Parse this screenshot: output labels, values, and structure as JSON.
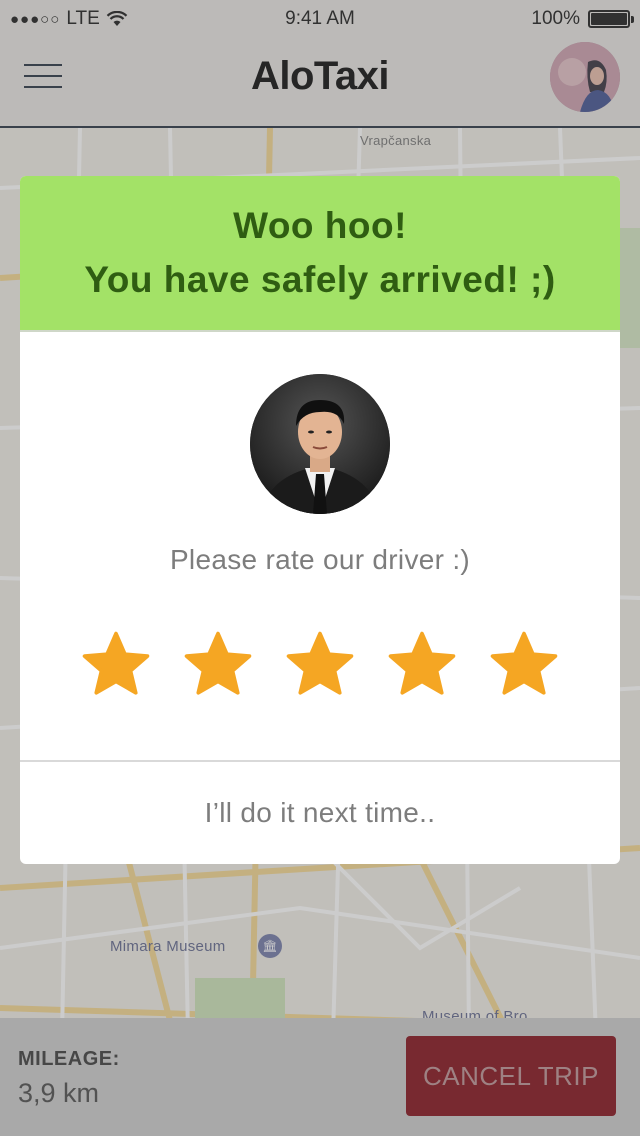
{
  "status_bar": {
    "signal": "●●●○○",
    "carrier": "LTE",
    "time": "9:41 AM",
    "battery_text": "100%"
  },
  "nav": {
    "title": "AloTaxi"
  },
  "map": {
    "street_label": "Vrapčanska",
    "poi_label": "Mimara Museum",
    "poi_label_2": "Museum of Bro"
  },
  "modal": {
    "title_line1": "Woo hoo!",
    "title_line2": "You have safely arrived! ;)",
    "rate_prompt": "Please rate our driver :)",
    "rating": {
      "value": 5,
      "max": 5
    },
    "later_label": "I’ll do it next time..",
    "accent_color": "#a3e267",
    "title_color": "#2f5d12",
    "star_color": "#f5a623"
  },
  "bottom_bar": {
    "mileage_label": "MILEAGE:",
    "mileage_value": "3,9 km",
    "cancel_label": "CANCEL TRIP",
    "cancel_color": "#7f0510"
  }
}
